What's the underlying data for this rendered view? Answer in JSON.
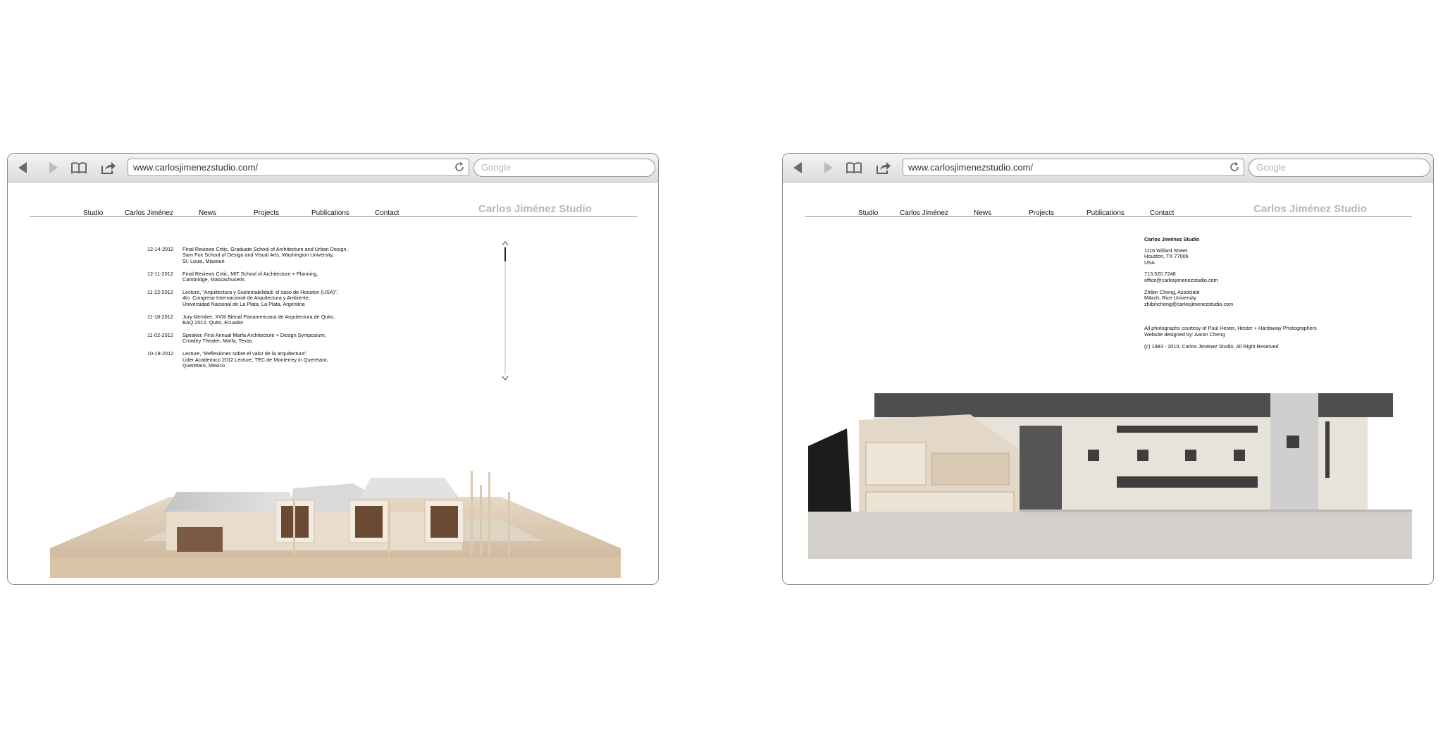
{
  "left_browser": {
    "url": "www.carlosjimenezstudio.com/",
    "search_placeholder": "Google",
    "nav": [
      "Studio",
      "Carlos Jiménez",
      "News",
      "Projects",
      "Publications",
      "Contact"
    ],
    "brand": "Carlos Jiménez Studio",
    "news": [
      {
        "date": "12-14-2012",
        "text": "Final Reviews Critic, Graduate School of Architecture and Urban Design,\nSam Fox School of Design and Visual Arts, Washington University,\nSt. Louis, Missouri"
      },
      {
        "date": "12-11-2012",
        "text": "Final Reviews Critic, MIT School of Architecture + Planning,\nCambridge, Massachusetts"
      },
      {
        "date": "11-22-2012",
        "text": "Lecture, “Arquitectura y Sustentabilidad: el caso de Houston (USA)”,\n4to. Congreso Internacional de Arquitectura y Ambiente,\nUniversidad Nacional de La Plata, La Plata, Argentina"
      },
      {
        "date": "11-18-2012",
        "text": "Jury Member, XVIII Bienal Panamericana de Arquitectura de Quito,\n BAQ 2012, Quito, Ecuador"
      },
      {
        "date": "11-02-2012",
        "text": "Speaker, First Annual Marfa Architecture + Design Symposium,\nCrowley Theater, Marfa, Texas"
      },
      {
        "date": "10-18-2012",
        "text": "Lecture, “Reflexiones sobre el valor de la arquitectura”,\nLider Academico 2012 Lecture, TEC de Monterrey in Queretaro,\nQueretaro, Mexico"
      }
    ]
  },
  "right_browser": {
    "url": "www.carlosjimenezstudio.com/",
    "search_placeholder": "Google",
    "nav": [
      "Studio",
      "Carlos Jiménez",
      "News",
      "Projects",
      "Publications",
      "Contact"
    ],
    "brand": "Carlos Jiménez Studio",
    "contact": {
      "title": "Carlos Jiménez Studio",
      "address": "1116 Willard Street\nHouston, TX 77006\nUSA",
      "phone_email": "713.520.7248\noffice@carlosjimenezstudio.com",
      "associate": "Zhibin Cheng, Associate\nMArch, Rice University\nzhibincheng@carlosjimenezstudio.com",
      "credits": "All photographs courtesy of Paul Hester, Hester + Hardaway Photographers\nWebsite designed by: Aaron Cheng",
      "copyright": "(c) 1983 - 2010, Carlos Jiménez Studio, All Right Reserved"
    }
  },
  "icons": {
    "back": "back-arrow-icon",
    "forward": "forward-arrow-icon",
    "bookmarks": "open-book-icon",
    "share": "share-icon",
    "reload": "reload-icon"
  }
}
